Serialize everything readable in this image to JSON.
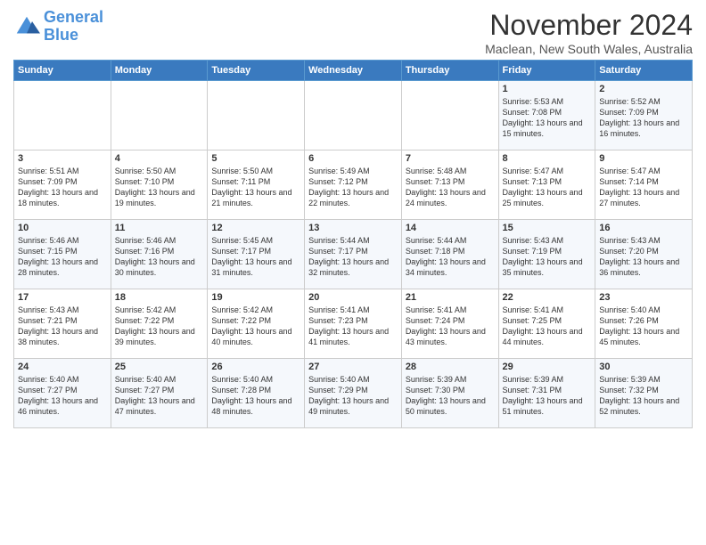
{
  "logo": {
    "text_general": "General",
    "text_blue": "Blue"
  },
  "header": {
    "title": "November 2024",
    "subtitle": "Maclean, New South Wales, Australia"
  },
  "days_of_week": [
    "Sunday",
    "Monday",
    "Tuesday",
    "Wednesday",
    "Thursday",
    "Friday",
    "Saturday"
  ],
  "weeks": [
    [
      {
        "day": "",
        "info": ""
      },
      {
        "day": "",
        "info": ""
      },
      {
        "day": "",
        "info": ""
      },
      {
        "day": "",
        "info": ""
      },
      {
        "day": "",
        "info": ""
      },
      {
        "day": "1",
        "info": "Sunrise: 5:53 AM\nSunset: 7:08 PM\nDaylight: 13 hours\nand 15 minutes."
      },
      {
        "day": "2",
        "info": "Sunrise: 5:52 AM\nSunset: 7:09 PM\nDaylight: 13 hours\nand 16 minutes."
      }
    ],
    [
      {
        "day": "3",
        "info": "Sunrise: 5:51 AM\nSunset: 7:09 PM\nDaylight: 13 hours\nand 18 minutes."
      },
      {
        "day": "4",
        "info": "Sunrise: 5:50 AM\nSunset: 7:10 PM\nDaylight: 13 hours\nand 19 minutes."
      },
      {
        "day": "5",
        "info": "Sunrise: 5:50 AM\nSunset: 7:11 PM\nDaylight: 13 hours\nand 21 minutes."
      },
      {
        "day": "6",
        "info": "Sunrise: 5:49 AM\nSunset: 7:12 PM\nDaylight: 13 hours\nand 22 minutes."
      },
      {
        "day": "7",
        "info": "Sunrise: 5:48 AM\nSunset: 7:13 PM\nDaylight: 13 hours\nand 24 minutes."
      },
      {
        "day": "8",
        "info": "Sunrise: 5:47 AM\nSunset: 7:13 PM\nDaylight: 13 hours\nand 25 minutes."
      },
      {
        "day": "9",
        "info": "Sunrise: 5:47 AM\nSunset: 7:14 PM\nDaylight: 13 hours\nand 27 minutes."
      }
    ],
    [
      {
        "day": "10",
        "info": "Sunrise: 5:46 AM\nSunset: 7:15 PM\nDaylight: 13 hours\nand 28 minutes."
      },
      {
        "day": "11",
        "info": "Sunrise: 5:46 AM\nSunset: 7:16 PM\nDaylight: 13 hours\nand 30 minutes."
      },
      {
        "day": "12",
        "info": "Sunrise: 5:45 AM\nSunset: 7:17 PM\nDaylight: 13 hours\nand 31 minutes."
      },
      {
        "day": "13",
        "info": "Sunrise: 5:44 AM\nSunset: 7:17 PM\nDaylight: 13 hours\nand 32 minutes."
      },
      {
        "day": "14",
        "info": "Sunrise: 5:44 AM\nSunset: 7:18 PM\nDaylight: 13 hours\nand 34 minutes."
      },
      {
        "day": "15",
        "info": "Sunrise: 5:43 AM\nSunset: 7:19 PM\nDaylight: 13 hours\nand 35 minutes."
      },
      {
        "day": "16",
        "info": "Sunrise: 5:43 AM\nSunset: 7:20 PM\nDaylight: 13 hours\nand 36 minutes."
      }
    ],
    [
      {
        "day": "17",
        "info": "Sunrise: 5:43 AM\nSunset: 7:21 PM\nDaylight: 13 hours\nand 38 minutes."
      },
      {
        "day": "18",
        "info": "Sunrise: 5:42 AM\nSunset: 7:22 PM\nDaylight: 13 hours\nand 39 minutes."
      },
      {
        "day": "19",
        "info": "Sunrise: 5:42 AM\nSunset: 7:22 PM\nDaylight: 13 hours\nand 40 minutes."
      },
      {
        "day": "20",
        "info": "Sunrise: 5:41 AM\nSunset: 7:23 PM\nDaylight: 13 hours\nand 41 minutes."
      },
      {
        "day": "21",
        "info": "Sunrise: 5:41 AM\nSunset: 7:24 PM\nDaylight: 13 hours\nand 43 minutes."
      },
      {
        "day": "22",
        "info": "Sunrise: 5:41 AM\nSunset: 7:25 PM\nDaylight: 13 hours\nand 44 minutes."
      },
      {
        "day": "23",
        "info": "Sunrise: 5:40 AM\nSunset: 7:26 PM\nDaylight: 13 hours\nand 45 minutes."
      }
    ],
    [
      {
        "day": "24",
        "info": "Sunrise: 5:40 AM\nSunset: 7:27 PM\nDaylight: 13 hours\nand 46 minutes."
      },
      {
        "day": "25",
        "info": "Sunrise: 5:40 AM\nSunset: 7:27 PM\nDaylight: 13 hours\nand 47 minutes."
      },
      {
        "day": "26",
        "info": "Sunrise: 5:40 AM\nSunset: 7:28 PM\nDaylight: 13 hours\nand 48 minutes."
      },
      {
        "day": "27",
        "info": "Sunrise: 5:40 AM\nSunset: 7:29 PM\nDaylight: 13 hours\nand 49 minutes."
      },
      {
        "day": "28",
        "info": "Sunrise: 5:39 AM\nSunset: 7:30 PM\nDaylight: 13 hours\nand 50 minutes."
      },
      {
        "day": "29",
        "info": "Sunrise: 5:39 AM\nSunset: 7:31 PM\nDaylight: 13 hours\nand 51 minutes."
      },
      {
        "day": "30",
        "info": "Sunrise: 5:39 AM\nSunset: 7:32 PM\nDaylight: 13 hours\nand 52 minutes."
      }
    ]
  ]
}
